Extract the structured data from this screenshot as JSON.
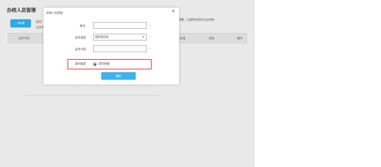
{
  "page": {
    "title": "办校人员管理",
    "add_button": "+新增",
    "warning_line1": "重要!",
    "warning_line2": "去修改",
    "tip_line1": "调整，为避免给您的企业带来",
    "tip_line2": "调",
    "table_headers": [
      "证件号码",
      "状态",
      "操作"
    ],
    "table_headers_extra": "办理"
  },
  "dialog": {
    "title": "办校人员添加",
    "close_label": "×",
    "name_label": "姓名",
    "name_value": "",
    "id_type_label": "证件类型",
    "id_type_value": "居民身份证",
    "id_type_caret": "▾",
    "id_number_label": "证件号码",
    "id_number_value": "",
    "required_mark": "*",
    "identity_label": "身份类型",
    "identity_option": "项目经理",
    "confirm_button": "确定"
  },
  "colors": {
    "primary": "#2ea8e6",
    "confirm": "#3db3ee",
    "highlight_border": "#e23b3b",
    "warning_text": "#e0453b",
    "panel_bg": "#e9e9e9"
  }
}
